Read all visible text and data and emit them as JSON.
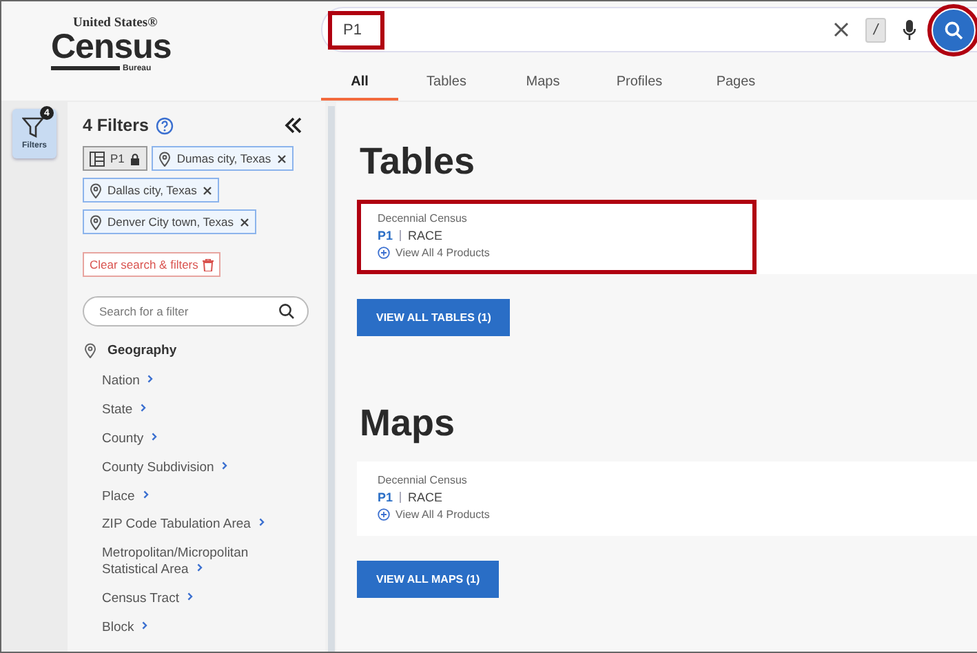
{
  "logo": {
    "line_1": "United States®",
    "line_2": "Census",
    "line_3": "Bureau"
  },
  "search": {
    "value": "P1",
    "value_highlighted": true,
    "shortcut": "/",
    "button_highlighted": true
  },
  "tabs": [
    {
      "label": "All",
      "selected": true
    },
    {
      "label": "Tables",
      "selected": false
    },
    {
      "label": "Maps",
      "selected": false
    },
    {
      "label": "Profiles",
      "selected": false
    },
    {
      "label": "Pages",
      "selected": false
    }
  ],
  "rail": {
    "label": "Filters",
    "badge": "4",
    "selected": true
  },
  "filters": {
    "title": "4 Filters",
    "chips": [
      {
        "kind": "table",
        "label": "P1",
        "locked": true
      },
      {
        "kind": "place",
        "label": "Dumas city, Texas"
      },
      {
        "kind": "place",
        "label": "Dallas city, Texas"
      },
      {
        "kind": "place",
        "label": "Denver City town, Texas"
      }
    ],
    "clear_button": "Clear search & filters",
    "search_placeholder": "Search for a filter",
    "section": "Geography",
    "items": [
      "Nation",
      "State",
      "County",
      "County Subdivision",
      "Place",
      "ZIP Code Tabulation Area",
      "Metropolitan/Micropolitan Statistical Area",
      "Census Tract",
      "Block"
    ]
  },
  "sections": [
    {
      "title": "Tables",
      "cards": [
        {
          "source": "Decennial Census",
          "code": "P1",
          "name": "RACE",
          "more": "View All 4 Products",
          "highlighted": true
        }
      ],
      "button": "VIEW ALL TABLES (1)"
    },
    {
      "title": "Maps",
      "cards": [
        {
          "source": "Decennial Census",
          "code": "P1",
          "name": "RACE",
          "more": "View All 4 Products",
          "highlighted": false
        }
      ],
      "button": "VIEW ALL MAPS (1)"
    }
  ]
}
